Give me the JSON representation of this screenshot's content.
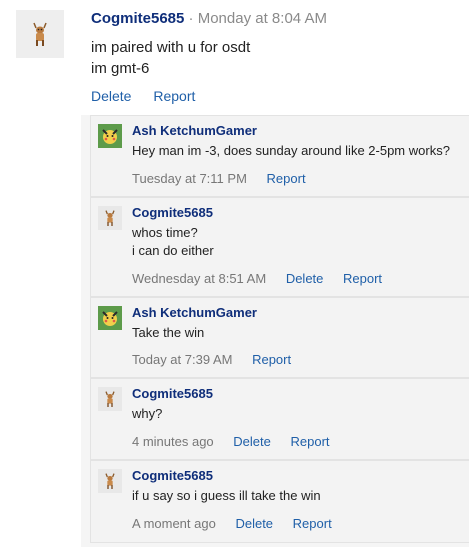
{
  "post": {
    "author": "Cogmite5685",
    "separator": "·",
    "time": "Monday at 8:04 AM",
    "lines": [
      "im paired with u for osdt",
      "im gmt-6"
    ],
    "delete_label": "Delete",
    "report_label": "Report"
  },
  "replies": [
    {
      "author": "Ash KetchumGamer",
      "avatar": "pikachu-avatar",
      "lines": [
        "Hey man im -3, does sunday around like 2-5pm works?"
      ],
      "time": "Tuesday at 7:11 PM",
      "report_label": "Report"
    },
    {
      "author": "Cogmite5685",
      "avatar": "deer-avatar",
      "lines": [
        "whos time?",
        "i can do either"
      ],
      "time": "Wednesday at 8:51 AM",
      "delete_label": "Delete",
      "report_label": "Report"
    },
    {
      "author": "Ash KetchumGamer",
      "avatar": "pikachu-avatar",
      "lines": [
        "Take the win"
      ],
      "time": "Today at 7:39 AM",
      "report_label": "Report"
    },
    {
      "author": "Cogmite5685",
      "avatar": "deer-avatar",
      "lines": [
        "why?"
      ],
      "time": "4 minutes ago",
      "delete_label": "Delete",
      "report_label": "Report"
    },
    {
      "author": "Cogmite5685",
      "avatar": "deer-avatar",
      "lines": [
        "if u say so i guess ill take the win"
      ],
      "time": "A moment ago",
      "delete_label": "Delete",
      "report_label": "Report"
    }
  ],
  "colors": {
    "author": "#0f2e7a",
    "link": "#1f5fa8",
    "muted": "#8a8a8a",
    "reply_bg": "#f3f3f3"
  }
}
